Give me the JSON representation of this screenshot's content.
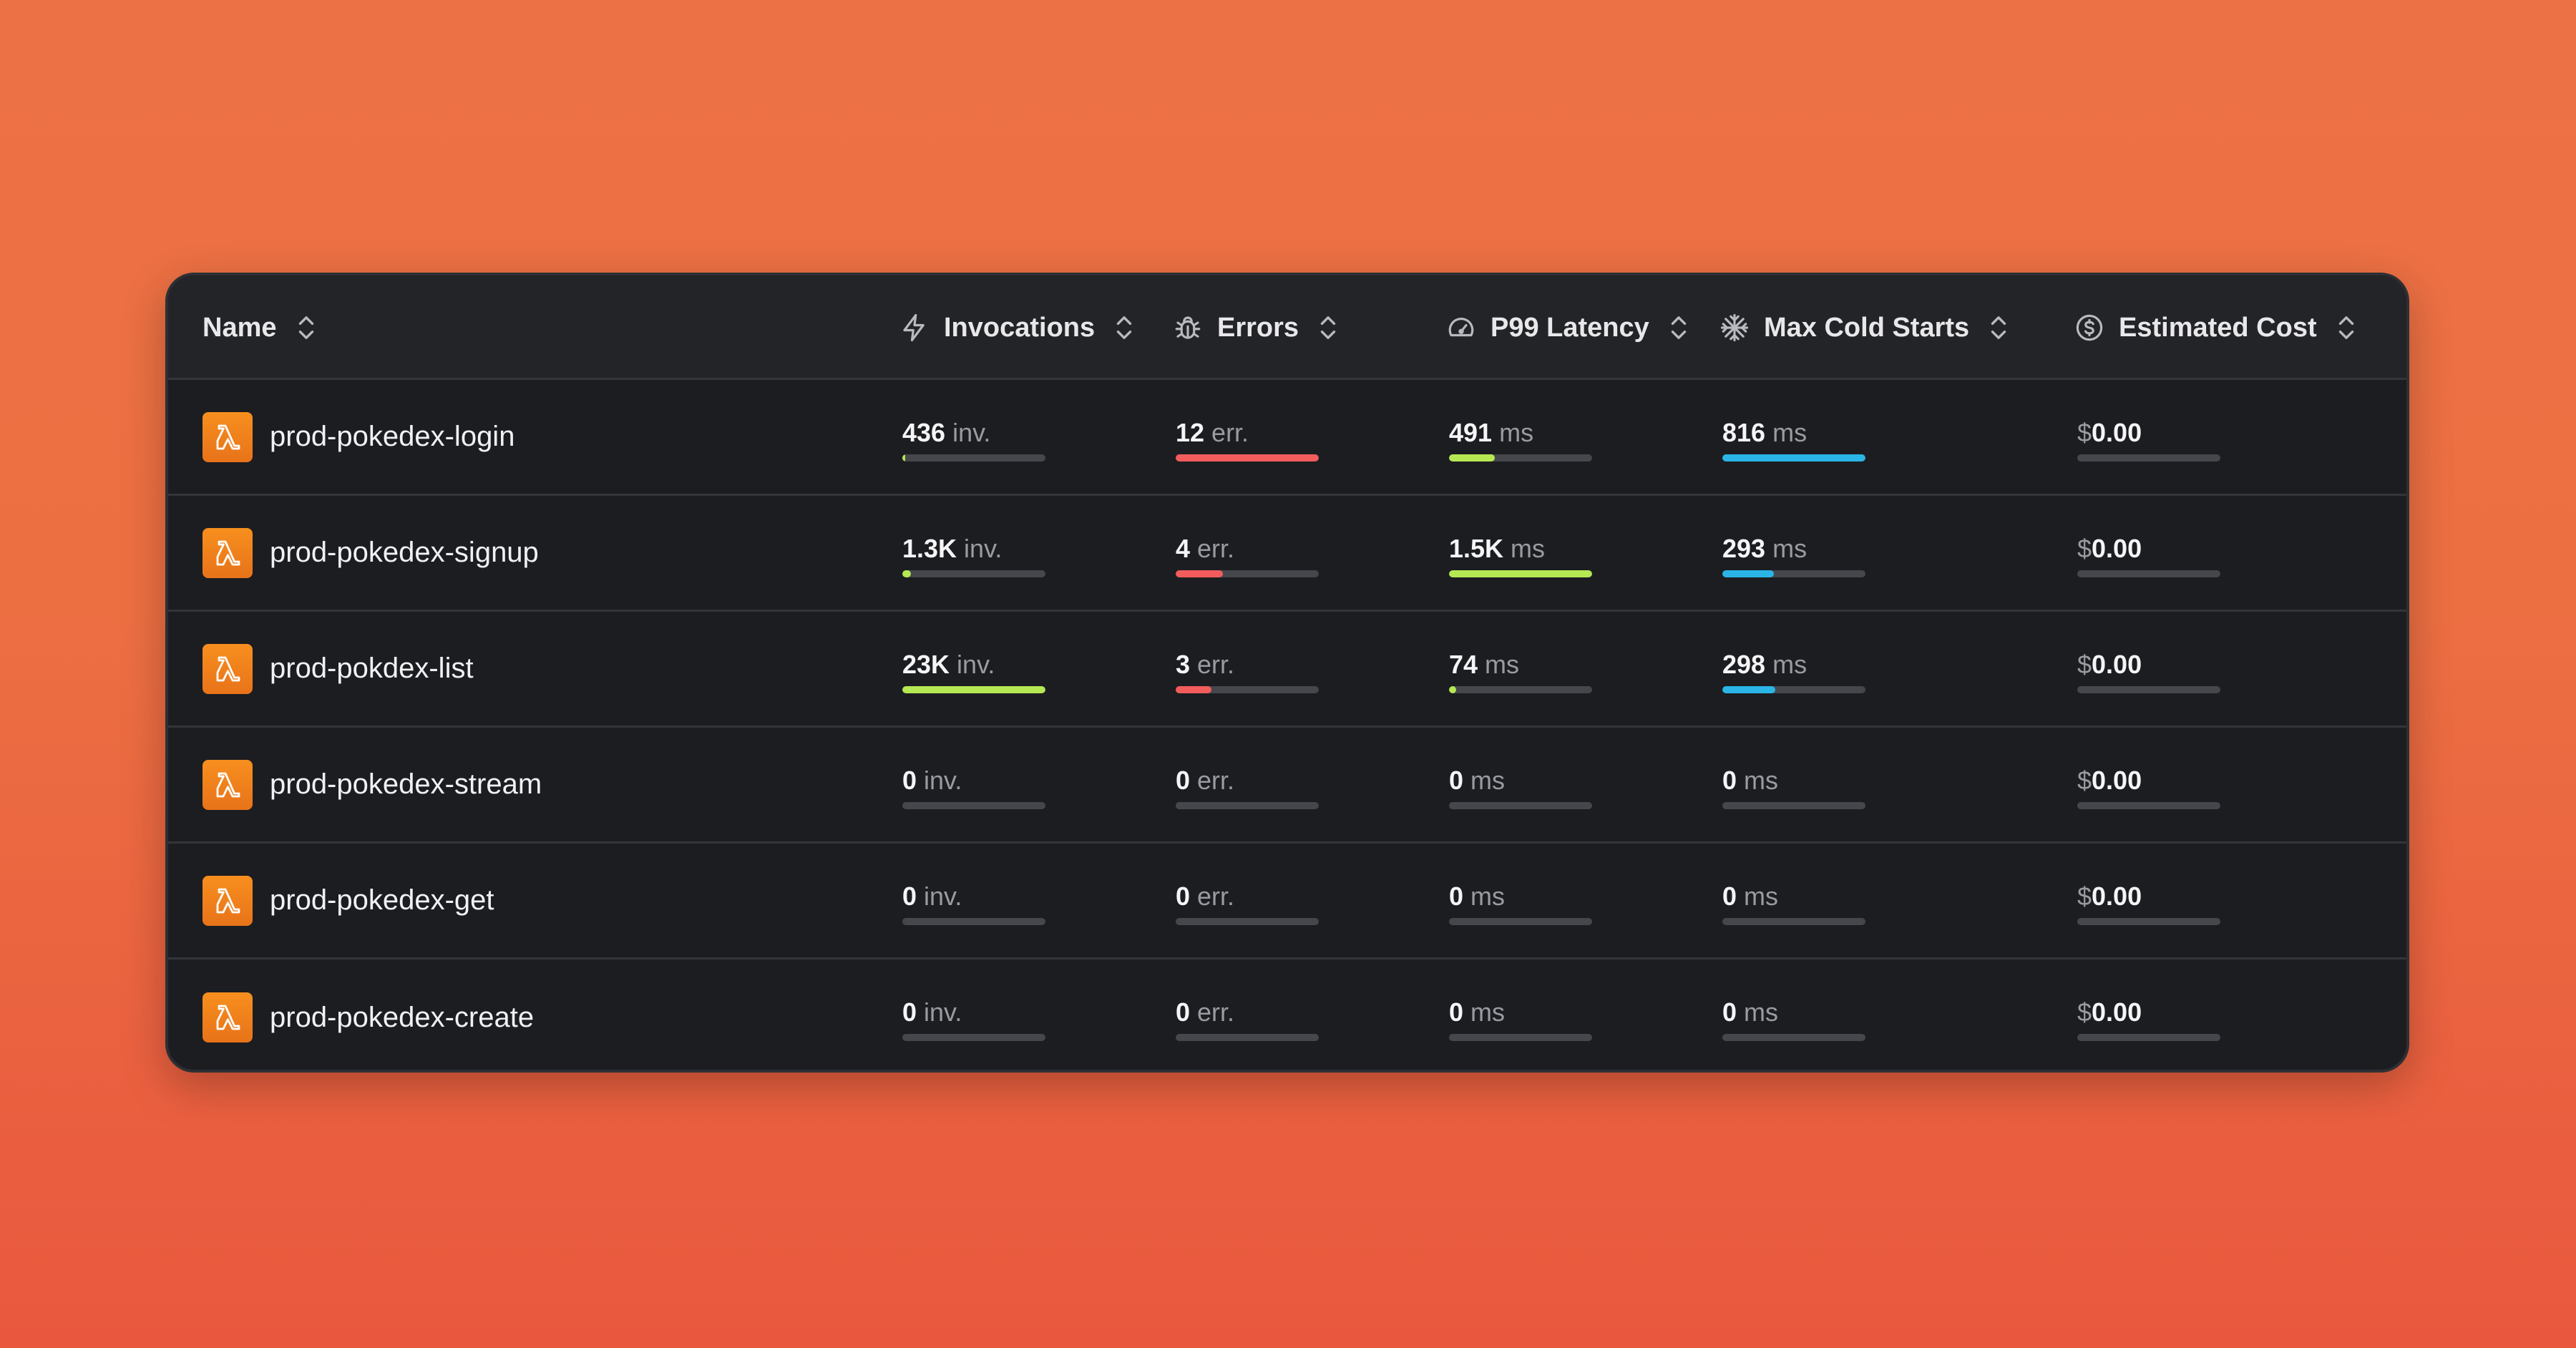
{
  "colors": {
    "invocations": "#b5e853",
    "errors": "#f25c5c",
    "latency": "#b5e853",
    "cold_starts": "#2ab5e6",
    "cost": "#b5e853"
  },
  "headers": {
    "name": "Name",
    "invocations": "Invocations",
    "errors": "Errors",
    "latency": "P99 Latency",
    "cold_starts": "Max Cold Starts",
    "cost": "Estimated Cost"
  },
  "units": {
    "invocations": "inv.",
    "errors": "err.",
    "latency": "ms",
    "cold_starts": "ms",
    "cost_symbol": "$"
  },
  "rows": [
    {
      "name": "prod-pokedex-login",
      "invocations": "436",
      "inv_pct": 2,
      "errors": "12",
      "err_pct": 100,
      "latency": "491",
      "lat_pct": 32,
      "cold": "816",
      "cold_pct": 100,
      "cost": "0.00",
      "cost_pct": 0
    },
    {
      "name": "prod-pokedex-signup",
      "invocations": "1.3K",
      "inv_pct": 6,
      "errors": "4",
      "err_pct": 33,
      "latency": "1.5K",
      "lat_pct": 100,
      "cold": "293",
      "cold_pct": 36,
      "cost": "0.00",
      "cost_pct": 0
    },
    {
      "name": "prod-pokdex-list",
      "invocations": "23K",
      "inv_pct": 100,
      "errors": "3",
      "err_pct": 25,
      "latency": "74",
      "lat_pct": 5,
      "cold": "298",
      "cold_pct": 37,
      "cost": "0.00",
      "cost_pct": 0
    },
    {
      "name": "prod-pokedex-stream",
      "invocations": "0",
      "inv_pct": 0,
      "errors": "0",
      "err_pct": 0,
      "latency": "0",
      "lat_pct": 0,
      "cold": "0",
      "cold_pct": 0,
      "cost": "0.00",
      "cost_pct": 0
    },
    {
      "name": "prod-pokedex-get",
      "invocations": "0",
      "inv_pct": 0,
      "errors": "0",
      "err_pct": 0,
      "latency": "0",
      "lat_pct": 0,
      "cold": "0",
      "cold_pct": 0,
      "cost": "0.00",
      "cost_pct": 0
    },
    {
      "name": "prod-pokedex-create",
      "invocations": "0",
      "inv_pct": 0,
      "errors": "0",
      "err_pct": 0,
      "latency": "0",
      "lat_pct": 0,
      "cold": "0",
      "cold_pct": 0,
      "cost": "0.00",
      "cost_pct": 0
    }
  ]
}
